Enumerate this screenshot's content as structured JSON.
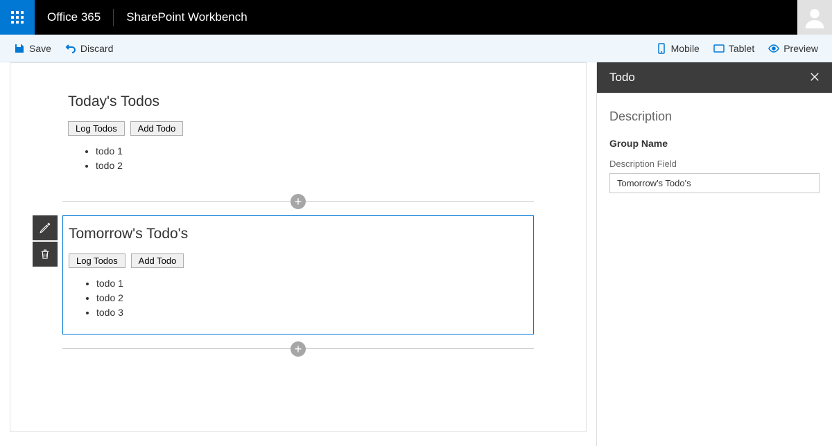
{
  "suite": {
    "brand": "Office 365",
    "product": "SharePoint Workbench"
  },
  "commandBar": {
    "save": "Save",
    "discard": "Discard",
    "mobile": "Mobile",
    "tablet": "Tablet",
    "preview": "Preview"
  },
  "webparts": [
    {
      "title": "Today's Todos",
      "logLabel": "Log Todos",
      "addLabel": "Add Todo",
      "items": [
        "todo 1",
        "todo 2"
      ],
      "selected": false
    },
    {
      "title": "Tomorrow's Todo's",
      "logLabel": "Log Todos",
      "addLabel": "Add Todo",
      "items": [
        "todo 1",
        "todo 2",
        "todo 3"
      ],
      "selected": true
    }
  ],
  "propertyPane": {
    "headerTitle": "Todo",
    "sectionTitle": "Description",
    "groupName": "Group Name",
    "fieldLabel": "Description Field",
    "fieldValue": "Tomorrow's Todo's"
  }
}
